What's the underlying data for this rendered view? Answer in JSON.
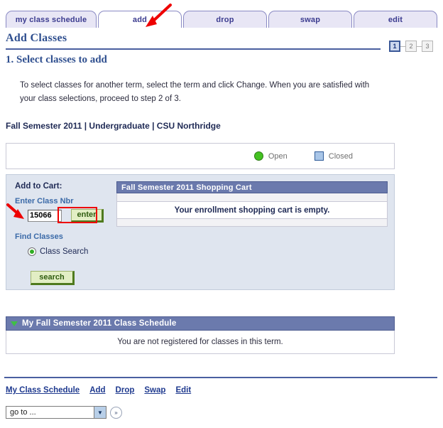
{
  "tabs": [
    {
      "label": "my class schedule",
      "active": false
    },
    {
      "label": "add",
      "active": true
    },
    {
      "label": "drop",
      "active": false
    },
    {
      "label": "swap",
      "active": false
    },
    {
      "label": "edit",
      "active": false
    }
  ],
  "page": {
    "title": "Add Classes",
    "section_heading": "1.  Select classes to add",
    "instructions": "To select classes for another term, select the term and click Change.  When you are satisfied with your class selections, proceed to step 2 of 3.",
    "term_line": "Fall Semester 2011 | Undergraduate | CSU Northridge"
  },
  "steps": [
    {
      "number": "1",
      "active": true
    },
    {
      "number": "2",
      "active": false
    },
    {
      "number": "3",
      "active": false
    }
  ],
  "legend": {
    "open_label": "Open",
    "closed_label": "Closed",
    "open_color": "#44c222",
    "closed_color": "#a9c6e8"
  },
  "add_to_cart": {
    "heading": "Add to Cart:",
    "class_nbr_label": "Enter Class Nbr",
    "class_nbr_value": "15066",
    "enter_button": "enter",
    "find_classes_label": "Find Classes",
    "class_search_label": "Class Search",
    "search_button": "search"
  },
  "shopping_cart": {
    "header": "Fall Semester 2011 Shopping Cart",
    "empty_message": "Your enrollment shopping cart is empty."
  },
  "schedule": {
    "header": "My Fall Semester 2011 Class Schedule",
    "message": "You are not registered for classes in this term."
  },
  "footer": {
    "links": [
      "My Class Schedule",
      "Add",
      "Drop",
      "Swap",
      "Edit"
    ],
    "goto_value": "go to ...",
    "goto_go_label": "»",
    "goto_caret": "▼"
  },
  "annotations": {
    "accent_color": "#ee0000",
    "arrow_add_tab": "arrow pointing to add tab",
    "arrow_class_nbr": "arrow pointing to class number field",
    "rect_enter_button": "highlight around enter button"
  }
}
